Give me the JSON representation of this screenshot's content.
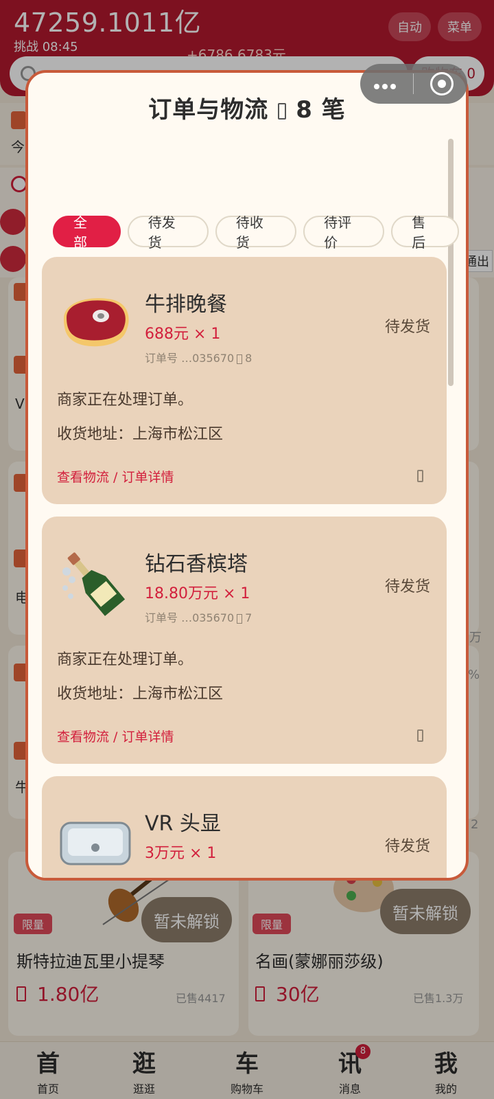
{
  "header": {
    "balance": "47259.1011亿",
    "challenge": "挑战 08:45",
    "delta": "+6786.6783元",
    "auto_label": "自动",
    "menu_label": "菜单",
    "cart_peek": "购物车 0"
  },
  "background_peeks": {
    "left_text_1": "今",
    "right_tag": "通出",
    "left_v": "V",
    "left_zh": "电",
    "left_niu": "牛",
    "right_wan": "万",
    "right_num": "2",
    "right_pct": "%"
  },
  "products": [
    {
      "name": "斯特拉迪瓦里小提琴",
      "price": "1.80亿",
      "sold": "已售4417",
      "tag": "限量",
      "button": "暂未解锁"
    },
    {
      "name": "名画(蒙娜丽莎级)",
      "price": "30亿",
      "sold": "已售1.3万",
      "tag": "限量",
      "button": "暂未解锁"
    }
  ],
  "tabbar": {
    "items": [
      {
        "glyph": "首",
        "label": "首页"
      },
      {
        "glyph": "逛",
        "label": "逛逛"
      },
      {
        "glyph": "车",
        "label": "购物车"
      },
      {
        "glyph": "讯",
        "label": "消息"
      },
      {
        "glyph": "我",
        "label": "我的"
      }
    ],
    "message_badge": "8"
  },
  "modal": {
    "title_left": "订单与物流",
    "title_right": "8 笔",
    "filters": [
      "全部",
      "待发货",
      "待收货",
      "待评价",
      "售后"
    ],
    "active_filter": "全部",
    "orders": [
      {
        "name": "牛排晚餐",
        "price": "688元 × 1",
        "order_no_prefix": "订单号 …035670",
        "order_no_suffix": "8",
        "status": "待发货",
        "message": "商家正在处理订单。",
        "address": "收货地址：上海市松江区",
        "link": "查看物流 / 订单详情",
        "icon": "steak-icon"
      },
      {
        "name": "钻石香槟塔",
        "price": "18.80万元 × 1",
        "order_no_prefix": "订单号 …035670",
        "order_no_suffix": "7",
        "status": "待发货",
        "message": "商家正在处理订单。",
        "address": "收货地址：上海市松江区",
        "link": "查看物流 / 订单详情",
        "icon": "champagne-icon"
      },
      {
        "name": "VR 头显",
        "price": "3万元 × 1",
        "status": "待发货",
        "icon": "vr-headset-icon"
      }
    ]
  },
  "colors": {
    "brand_red": "#b3192f",
    "accent_red": "#e11f45",
    "card_bg": "#ead3bb",
    "modal_border": "#c85a3a"
  }
}
